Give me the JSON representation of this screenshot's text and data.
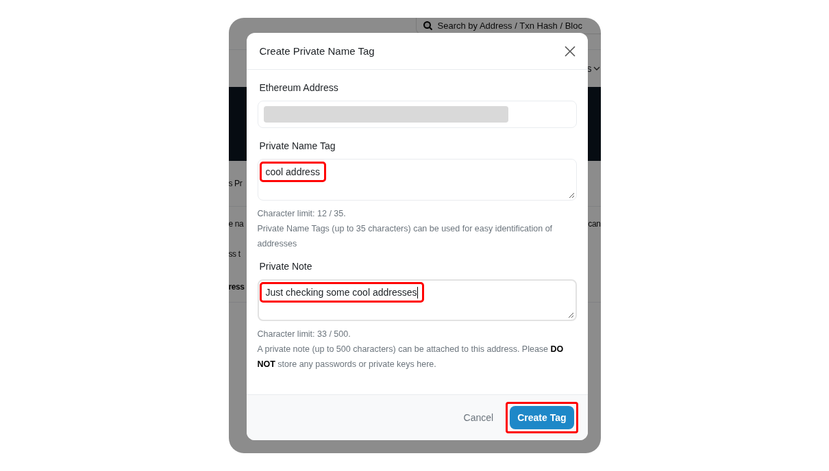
{
  "background_page": {
    "search": {
      "placeholder": "Search by Address / Txn Hash / Bloc"
    },
    "nav_fragment": "s",
    "title_fragment": "s Pr",
    "text_fragments": [
      "e na",
      "can"
    ],
    "link_fragment": "ss t",
    "bold_fragment": "ress"
  },
  "dialog": {
    "title": "Create Private Name Tag",
    "fields": [
      {
        "kind": "address",
        "label": "Ethereum Address"
      },
      {
        "kind": "textarea",
        "label": "Private Name Tag",
        "value": "cool address",
        "highlighted": true,
        "focused": false,
        "counter": "Character limit: 12 / 35.",
        "help": "Private Name Tags (up to 35 characters) can be used for easy identification of addresses"
      },
      {
        "kind": "textarea",
        "label": "Private Note",
        "value": "Just checking some cool addresses",
        "highlighted": true,
        "focused": true,
        "counter": "Character limit: 33 / 500.",
        "help": "A private note (up to 500 characters) can be attached to this address. Please **DO NOT** store any passwords or private keys here."
      }
    ],
    "cancel": "Cancel",
    "submit": {
      "label": "Create Tag",
      "highlighted": true
    }
  }
}
